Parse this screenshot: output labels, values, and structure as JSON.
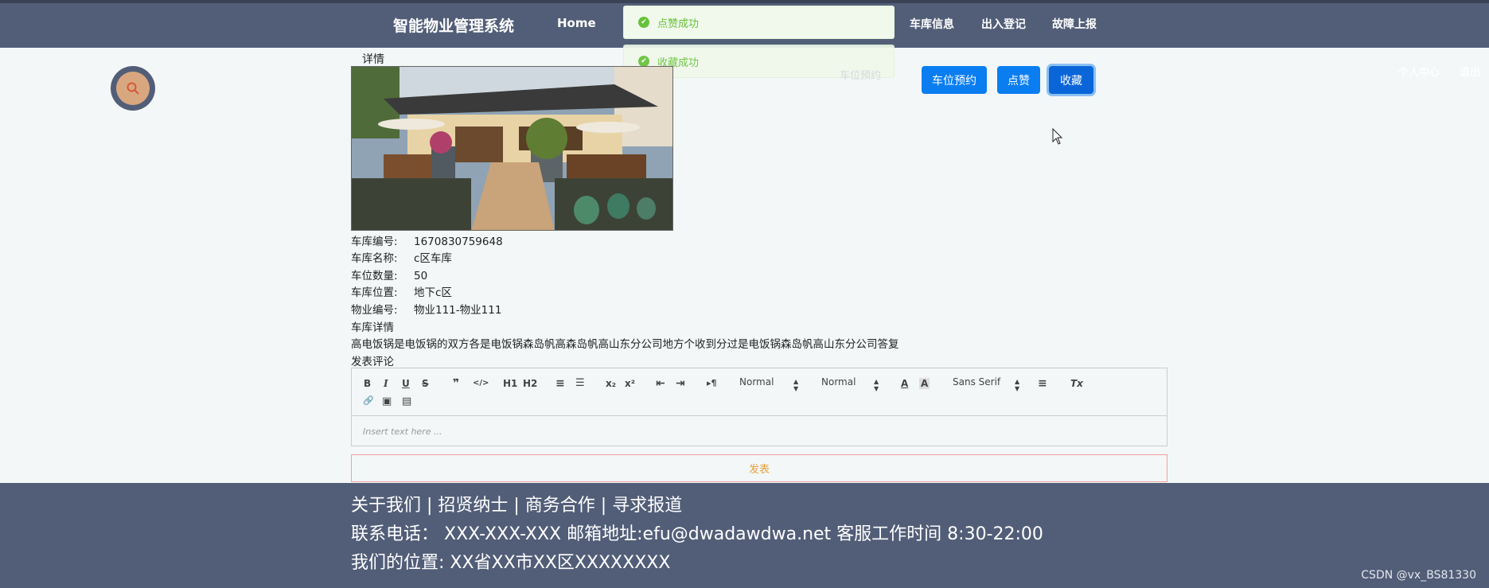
{
  "header": {
    "brand": "智能物业管理系统",
    "nav": {
      "home": "Home",
      "garage_info": "车库信息",
      "entry_registration": "出入登记",
      "fault_report": "故障上报"
    },
    "personal_center": "个人中心",
    "logout": "退出"
  },
  "toasts": [
    {
      "text": "点赞成功",
      "type": "success"
    },
    {
      "text": "收藏成功",
      "type": "success"
    }
  ],
  "page": {
    "section_label": "详情",
    "faded_action": "车位预约",
    "buttons": {
      "reserve": "车位预约",
      "like": "点赞",
      "favorite": "收藏"
    }
  },
  "details": {
    "rows": [
      {
        "label": "车库编号:",
        "value": "1670830759648"
      },
      {
        "label": "车库名称:",
        "value": "c区车库"
      },
      {
        "label": "车位数量:",
        "value": "50"
      },
      {
        "label": "车库位置:",
        "value": "地下c区"
      },
      {
        "label": "物业编号:",
        "value": "物业111-物业111"
      }
    ],
    "detail_title": "车库详情",
    "detail_text": "高电饭锅是电饭锅的双方各是电饭锅森岛帆高森岛帆高山东分公司地方个收到分过是电饭锅森岛帆高山东分公司答复",
    "comment_title": "发表评论"
  },
  "editor": {
    "placeholder": "Insert text here ...",
    "toolbar": {
      "bold": "B",
      "italic": "I",
      "underline": "U",
      "strike": "S",
      "quote": "❞",
      "code": "</>",
      "h1": "H1",
      "h2": "H2",
      "ordered_list": "≡",
      "bullet_list": "☰",
      "subscript": "x₂",
      "superscript": "x²",
      "outdent": "⇤",
      "indent": "⇥",
      "direction": "▸¶",
      "size_value": "Normal",
      "header_value": "Normal",
      "font_value": "Sans Serif",
      "color": "A",
      "background": "A",
      "align": "≡",
      "clean": "Tx",
      "link": "🔗",
      "image": "▣",
      "video": "▤"
    },
    "submit_label": "发表"
  },
  "footer": {
    "line1": "关于我们 | 招贤纳士 | 商务合作 | 寻求报道",
    "line2": "联系电话： XXX-XXX-XXX 邮箱地址:efu@dwadawdwa.net 客服工作时间 8:30-22:00",
    "line3": "我们的位置: XX省XX市XX区XXXXXXXX"
  },
  "watermark": "CSDN @vx_BS81330",
  "colors": {
    "navbar": "#525e78",
    "primary_button": "#0a7ef0",
    "success_toast": "#67c23a",
    "submit_text": "#e6a23c"
  }
}
